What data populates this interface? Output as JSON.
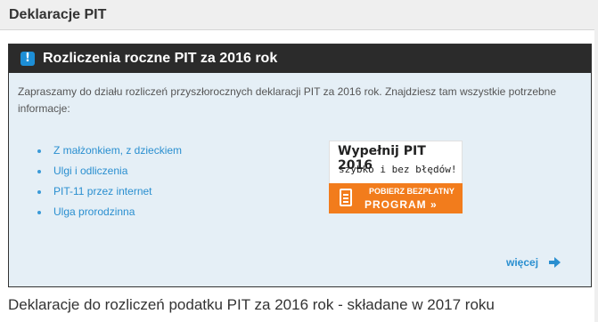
{
  "header": {
    "title": "Deklaracje PIT"
  },
  "box": {
    "title": "Rozliczenia roczne PIT za 2016 rok",
    "intro": "Zapraszamy do działu rozliczeń przyszłorocznych deklaracji PIT za 2016 rok. Znajdziesz tam wszystkie potrzebne informacje:",
    "links": [
      "Z małżonkiem, z dzieckiem",
      "Ulgi i odliczenia",
      "PIT-11 przez internet",
      "Ulga prorodzinna"
    ],
    "more": "więcej",
    "alert_icon": "!"
  },
  "ad": {
    "headline": "Wypełnij PIT 2016",
    "subline": "szybko i bez błędów!",
    "button_line1": "POBIERZ BEZPŁATNY",
    "button_line2": "PROGRAM »"
  },
  "footer": {
    "title": "Deklaracje do rozliczeń podatku PIT za 2016 rok - składane w 2017 roku"
  },
  "colors": {
    "accent": "#2a8fd0",
    "button": "#f27c1c",
    "box_bg": "#e5eff6",
    "header_bar": "#2b2b2b"
  },
  "icons": {
    "alert": "exclamation-icon",
    "more": "arrow-right-icon",
    "form": "document-icon"
  }
}
